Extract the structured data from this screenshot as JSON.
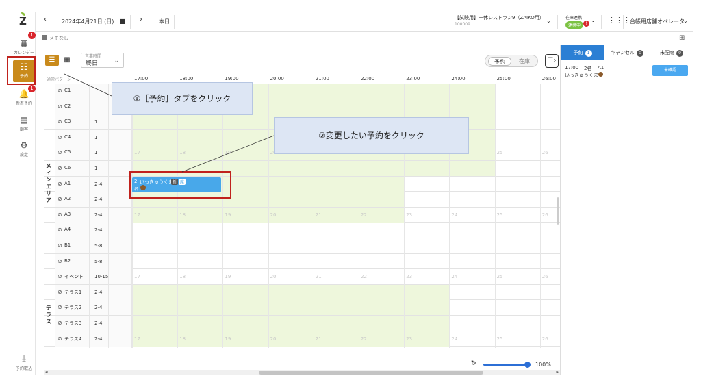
{
  "sidebar": {
    "calendar_label": "カレンダー",
    "calendar_badge": "1",
    "reserve_label": "予約",
    "new_label": "新着予約",
    "new_badge": "1",
    "customer_label": "顧客",
    "settings_label": "設定",
    "import_label": "予約取込"
  },
  "topbar": {
    "date": "2024年4月21日 (日)",
    "today": "本日",
    "store_name": "【試験用】一休レストラン9（ZAIKO用）",
    "store_id": "100009",
    "stock_sync_label": "在庫連携",
    "stock_sync_status": "連携中",
    "stock_badge": "!",
    "operator": "台帳用店舗オペレータ"
  },
  "memo": {
    "label": "メモなし"
  },
  "toolbar": {
    "time_label": "営業時間",
    "time_value": "終日",
    "seg_reserve": "予約",
    "seg_stock": "在庫"
  },
  "grid": {
    "header_label": "通常パターン",
    "hours": [
      "17:00",
      "18:00",
      "19:00",
      "20:00",
      "21:00",
      "22:00",
      "23:00",
      "24:00",
      "25:00",
      "26:00"
    ],
    "ghost_hours": [
      "17",
      "18",
      "19",
      "20",
      "21",
      "22",
      "23",
      "24",
      "25",
      "26"
    ],
    "area_main": "メインエリア",
    "area_terrace": "テラス",
    "rows": [
      {
        "name": "C1",
        "cap": ""
      },
      {
        "name": "C2",
        "cap": ""
      },
      {
        "name": "C3",
        "cap": "1"
      },
      {
        "name": "C4",
        "cap": "1"
      },
      {
        "name": "C5",
        "cap": "1"
      },
      {
        "name": "C6",
        "cap": "1"
      },
      {
        "name": "A1",
        "cap": "2-4"
      },
      {
        "name": "A2",
        "cap": "2-4"
      },
      {
        "name": "A3",
        "cap": "2-4"
      },
      {
        "name": "A4",
        "cap": "2-4"
      },
      {
        "name": "B1",
        "cap": "5-8"
      },
      {
        "name": "B2",
        "cap": "5-8"
      },
      {
        "name": "イベント",
        "cap": "10-15"
      },
      {
        "name": "テラス1",
        "cap": "2-4"
      },
      {
        "name": "テラス2",
        "cap": "2-4"
      },
      {
        "name": "テラス3",
        "cap": "2-4"
      },
      {
        "name": "テラス4",
        "cap": "2-4"
      }
    ]
  },
  "reservation": {
    "party": "2",
    "name": "いっきゅうくま",
    "tag1": "新",
    "tag2": "席",
    "sub": "名"
  },
  "callouts": {
    "step1": "①［予約］タブをクリック",
    "step2": "②変更したい予約をクリック"
  },
  "rpanel": {
    "tab_reserve": "予約",
    "tab_reserve_count": "1",
    "tab_cancel": "キャンセル",
    "tab_cancel_count": "0",
    "tab_unassigned": "未配席",
    "tab_unassigned_count": "0",
    "item_time": "17:00",
    "item_party": "2名",
    "item_table": "A1",
    "item_name": "いっきゅうくま",
    "item_status": "未確認"
  },
  "bottom": {
    "zoom": "100%"
  },
  "colors": {
    "accent": "#c98a1b",
    "green_cell": "#eef7dc",
    "reservation": "#48a8ea",
    "highlight": "#c0221d",
    "panel_blue": "#2b7fd4"
  }
}
